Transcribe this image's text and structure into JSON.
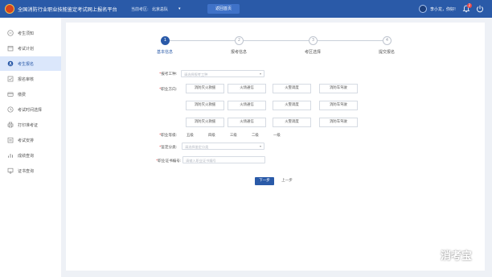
{
  "header": {
    "title": "全国消防行业职业技能鉴定考试网上报名平台",
    "region_label": "当前考区:",
    "region_value": "北京总队",
    "home_button": "返回首页",
    "greeting": "李小龙，你好!",
    "notification_count": "2"
  },
  "sidebar": {
    "items": [
      {
        "label": "考生须知",
        "icon": "clipboard-icon",
        "active": false
      },
      {
        "label": "考试计划",
        "icon": "calendar-icon",
        "active": false
      },
      {
        "label": "考生报名",
        "icon": "user-add-icon",
        "active": true
      },
      {
        "label": "报名审核",
        "icon": "check-icon",
        "active": false
      },
      {
        "label": "缴费",
        "icon": "payment-icon",
        "active": false
      },
      {
        "label": "考试时间选择",
        "icon": "clock-icon",
        "active": false
      },
      {
        "label": "打印准考证",
        "icon": "print-icon",
        "active": false
      },
      {
        "label": "考试安排",
        "icon": "schedule-icon",
        "active": false
      },
      {
        "label": "成绩查询",
        "icon": "chart-icon",
        "active": false
      },
      {
        "label": "证书查询",
        "icon": "certificate-icon",
        "active": false
      }
    ]
  },
  "steps": [
    {
      "number": "1",
      "label": "基本信息",
      "done": true
    },
    {
      "number": "2",
      "label": "报考信息",
      "done": false
    },
    {
      "number": "3",
      "label": "考区选择",
      "done": false
    },
    {
      "number": "4",
      "label": "提交报名",
      "done": false
    }
  ],
  "form": {
    "trade_label": "报考工种:",
    "trade_placeholder": "请选择报考工种",
    "direction_label": "职业方向:",
    "direction_options": [
      [
        "消防灭火救援",
        "火场通信",
        "火警调度",
        "消防车驾驶"
      ],
      [
        "消防灭火救援",
        "火场通信",
        "火警调度",
        "消防车驾驶"
      ],
      [
        "消防灭火救援",
        "火场通信",
        "火警调度",
        "消防车驾驶"
      ]
    ],
    "level_label": "职业等级:",
    "levels": [
      "五级",
      "四级",
      "三级",
      "二级",
      "一级"
    ],
    "category_label": "鉴定分类:",
    "category_placeholder": "请选择鉴定分类",
    "cert_label": "职业证书编号:",
    "cert_placeholder": "请输入职业证书编号",
    "required_mark": "*",
    "next_button": "下一步",
    "prev_button": "上一步"
  },
  "watermark": {
    "text": "消考宝"
  },
  "colors": {
    "primary": "#2a5aa8",
    "active_bg": "#dbe7fb",
    "alert": "#e84a4a"
  }
}
